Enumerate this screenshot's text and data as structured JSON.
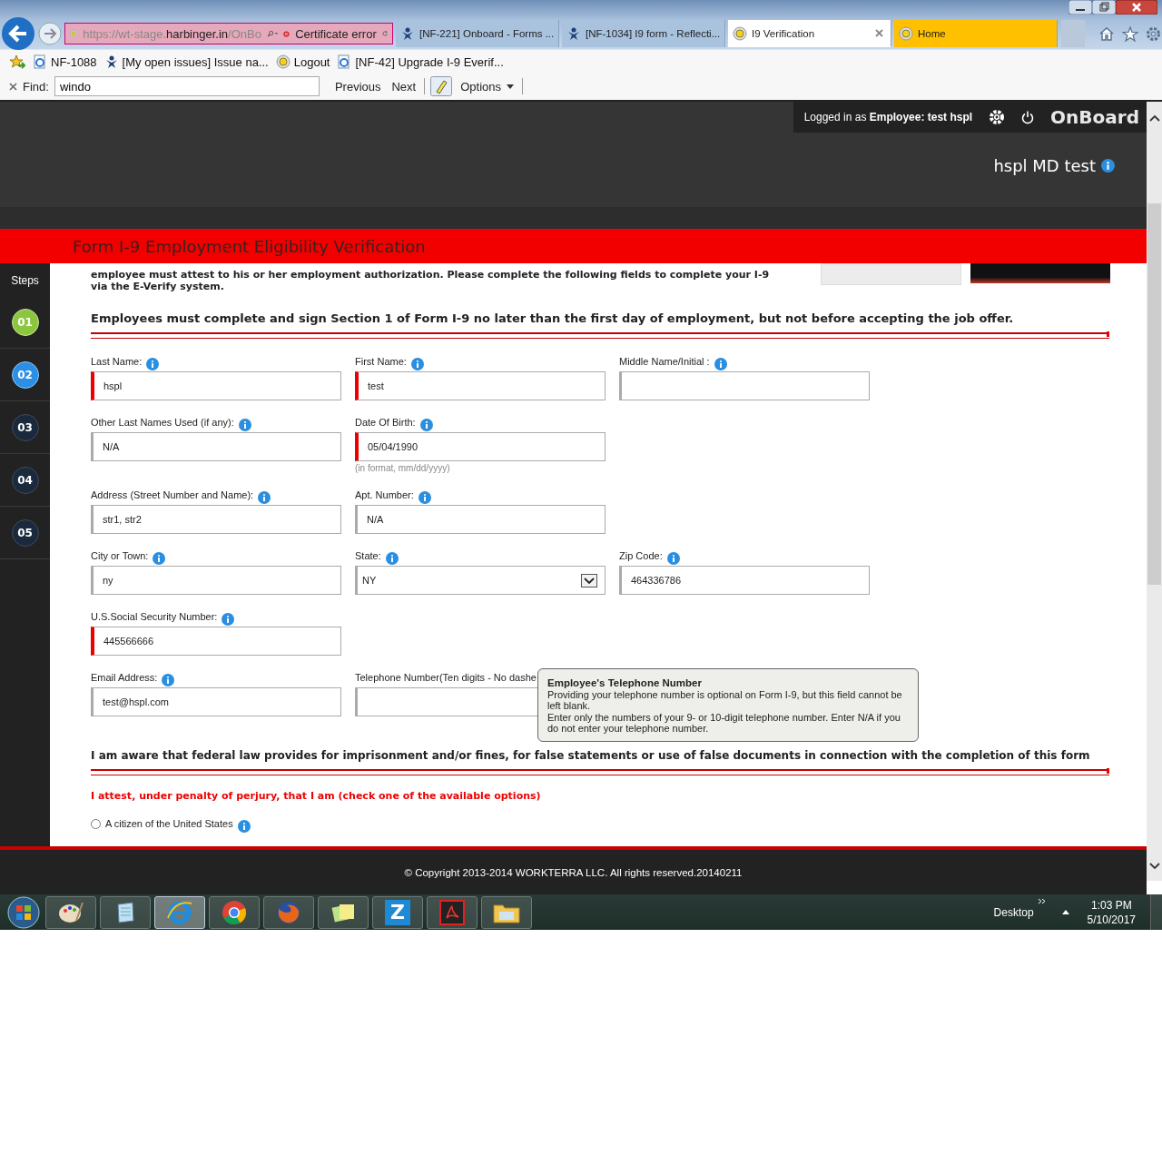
{
  "browser": {
    "address": {
      "prefix": "https://wt-stage.",
      "domain": "harbinger.in",
      "suffix": "/OnBo",
      "error": "Certificate error"
    },
    "tabs": [
      {
        "label": "[NF-221] Onboard - Forms ...",
        "kind": "jira",
        "selected": false,
        "color": "#a9c3df"
      },
      {
        "label": "[NF-1034] I9 form - Reflecti...",
        "kind": "jira",
        "selected": false,
        "color": "#a9c3df"
      },
      {
        "label": "I9 Verification",
        "kind": "globe",
        "selected": true,
        "color": "#ffffff"
      },
      {
        "label": "Home",
        "kind": "globe",
        "selected": false,
        "color": "#ffc000"
      }
    ],
    "favorites": [
      {
        "label": "NF-1088",
        "kind": "page"
      },
      {
        "label": "[My open issues] Issue na...",
        "kind": "jira"
      },
      {
        "label": "Logout",
        "kind": "globe"
      },
      {
        "label": "[NF-42] Upgrade I-9 Everif...",
        "kind": "page"
      }
    ],
    "find": {
      "label": "Find:",
      "value": "windo",
      "previous": "Previous",
      "next": "Next",
      "options": "Options"
    }
  },
  "header": {
    "logged_in": "Logged in as **Employee:**  **test hspl**",
    "brand": "OnBoard",
    "company": "hspl MD test"
  },
  "page_title": "Form I-9 Employment Eligibility Verification",
  "steps": {
    "title": "Steps",
    "items": [
      {
        "label": "01",
        "completed": true,
        "selected": false
      },
      {
        "label": "02",
        "completed": false,
        "selected": true
      },
      {
        "label": "03",
        "completed": false,
        "selected": false
      },
      {
        "label": "04",
        "completed": false,
        "selected": false
      },
      {
        "label": "05",
        "completed": false,
        "selected": false
      }
    ]
  },
  "intro": "employee must attest to his or her employment authorization. Please complete the following fields to complete your I-9 via the E-Verify system.",
  "section_heading": "Employees must complete and sign Section 1 of Form I-9 no later than the first day of employment, but not before accepting the job offer.",
  "field_rows": [
    [
      {
        "label": "Last Name:",
        "kind": "text",
        "value": "hspl",
        "required": true
      },
      {
        "label": "First Name:",
        "kind": "text",
        "value": "test",
        "required": true
      },
      {
        "label": "Middle Name/Initial :",
        "kind": "text",
        "required": false
      }
    ],
    [
      {
        "label": "Other Last Names Used (if any):",
        "kind": "text",
        "value": "N/A",
        "required": false
      },
      {
        "label": "Date Of Birth:",
        "kind": "text",
        "value": "05/04/1990",
        "required": true,
        "hint": "(in format, mm/dd/yyyy)"
      }
    ],
    [
      {
        "label": "Address (Street Number and Name):",
        "kind": "text",
        "value": "str1, str2",
        "required": false
      },
      {
        "label": "Apt. Number:",
        "kind": "text",
        "value": "N/A",
        "required": false
      }
    ],
    [
      {
        "label": "City or Town:",
        "kind": "text",
        "value": "ny",
        "required": false
      },
      {
        "label": "State:",
        "kind": "select",
        "value": "NY",
        "required": false
      },
      {
        "label": "Zip Code:",
        "kind": "text",
        "value": "464336786",
        "required": false
      }
    ],
    [
      {
        "label": "U.S.Social Security Number:",
        "kind": "text",
        "value": "445566666",
        "required": true
      }
    ],
    [
      {
        "label": "Email Address:",
        "kind": "text",
        "value": "test@hspl.com",
        "required": false
      },
      {
        "label": "Telephone Number(Ten digits - No dashe",
        "kind": "text",
        "required": false
      }
    ]
  ],
  "tooltip": {
    "title": "Employee's Telephone Number",
    "lines": [
      "Providing your telephone number is optional on Form I-9, but this field cannot be left blank.",
      "Enter only the numbers of your 9- or 10-digit telephone number. Enter N/A if you do not enter your telephone number."
    ]
  },
  "awareness": "I am aware that federal law provides for imprisonment and/or fines, for false statements or use of false documents in connection with the completion of this form",
  "attest": "I attest, under penalty of perjury, that I am (check one of the available options)",
  "options": [
    {
      "label": "A citizen of the United States",
      "selected": false
    }
  ],
  "footer": "© Copyright 2013-2014 WORKTERRA LLC. All rights reserved.20140211",
  "taskbar": {
    "apps": [
      {
        "kind": "paint",
        "selected": false
      },
      {
        "kind": "notepad",
        "selected": false
      },
      {
        "kind": "ie",
        "selected": true
      },
      {
        "kind": "chrome",
        "selected": false
      },
      {
        "kind": "firefox",
        "selected": false
      },
      {
        "kind": "notes",
        "selected": false
      },
      {
        "kind": "letter",
        "glyph": "Z",
        "selected": false
      },
      {
        "kind": "pdf",
        "selected": false
      },
      {
        "kind": "folder",
        "selected": false
      }
    ],
    "desktop": "Desktop",
    "time": "1:03 PM",
    "date": "5/10/2017"
  }
}
